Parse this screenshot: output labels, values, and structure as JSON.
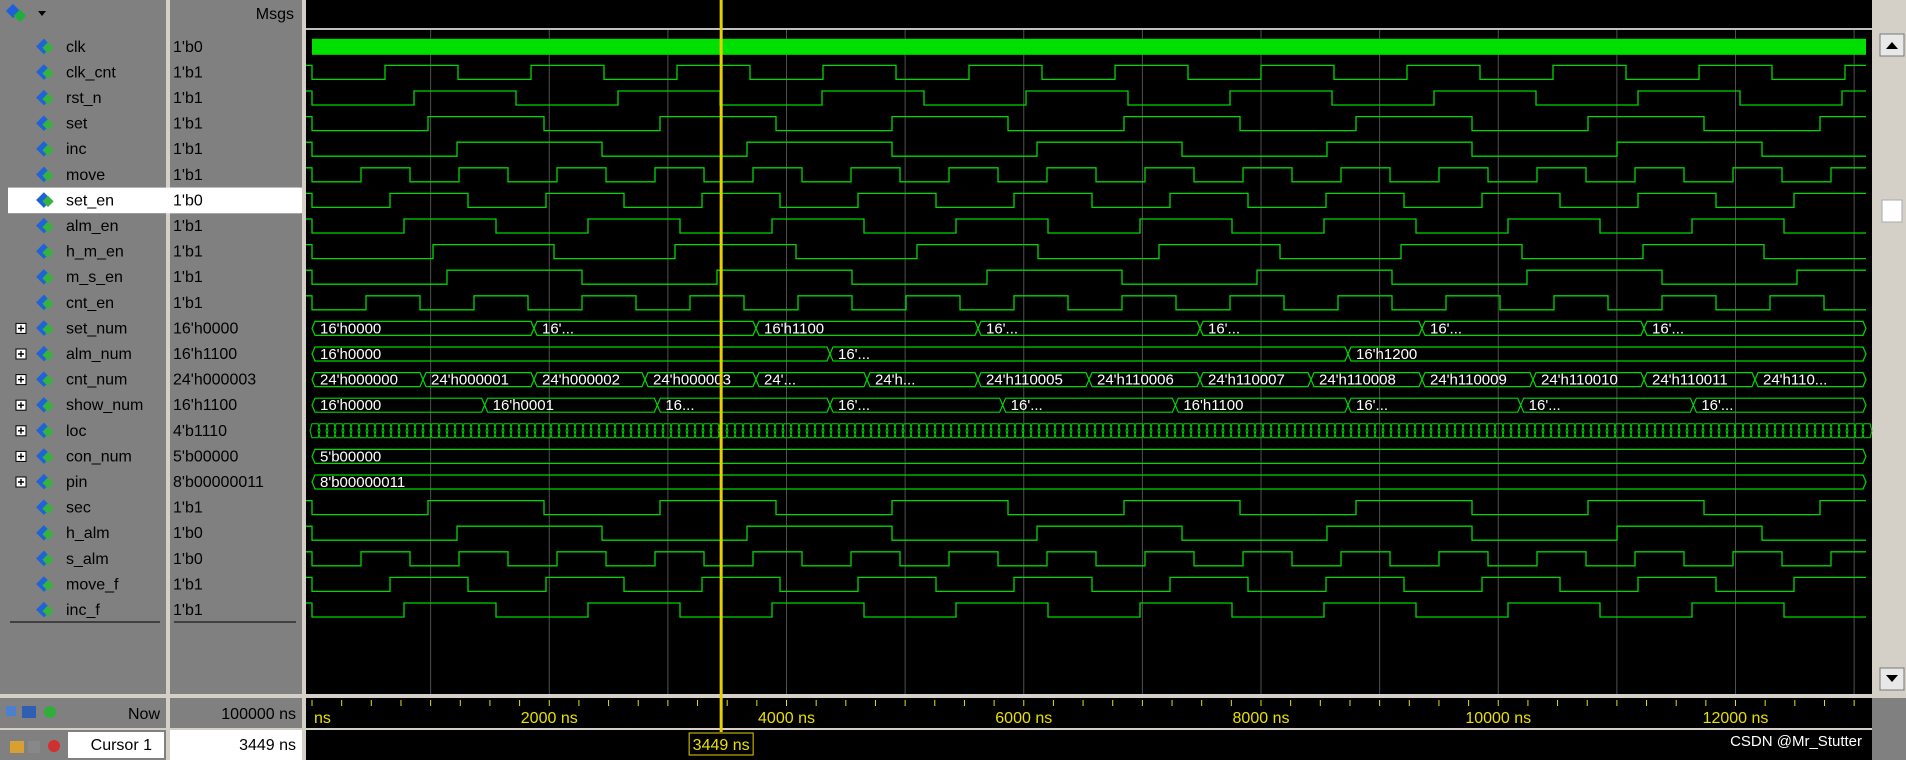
{
  "header": {
    "msgs_label": "Msgs"
  },
  "signals": [
    {
      "name": "clk",
      "value": "1'b0",
      "type": "clk"
    },
    {
      "name": "clk_cnt",
      "value": "1'b1",
      "type": "bit"
    },
    {
      "name": "rst_n",
      "value": "1'b1",
      "type": "bit"
    },
    {
      "name": "set",
      "value": "1'b1",
      "type": "bit"
    },
    {
      "name": "inc",
      "value": "1'b1",
      "type": "bit"
    },
    {
      "name": "move",
      "value": "1'b1",
      "type": "bit"
    },
    {
      "name": "set_en",
      "value": "1'b0",
      "type": "bit",
      "selected": true
    },
    {
      "name": "alm_en",
      "value": "1'b1",
      "type": "bit"
    },
    {
      "name": "h_m_en",
      "value": "1'b1",
      "type": "bit"
    },
    {
      "name": "m_s_en",
      "value": "1'b1",
      "type": "bit"
    },
    {
      "name": "cnt_en",
      "value": "1'b1",
      "type": "bit"
    },
    {
      "name": "set_num",
      "value": "16'h0000",
      "type": "bus",
      "expandable": true,
      "labels": [
        "16'h0000",
        "16'...",
        "16'h1100",
        "16'...",
        "16'...",
        "16'...",
        "16'..."
      ]
    },
    {
      "name": "alm_num",
      "value": "16'h1100",
      "type": "bus",
      "expandable": true,
      "labels": [
        "16'h0000",
        "16'...",
        "16'h1200"
      ]
    },
    {
      "name": "cnt_num",
      "value": "24'h000003",
      "type": "bus",
      "expandable": true,
      "labels": [
        "24'h000000",
        "24'h000001",
        "24'h000002",
        "24'h000003",
        "24'...",
        "24'h...",
        "24'h110005",
        "24'h110006",
        "24'h110007",
        "24'h110008",
        "24'h110009",
        "24'h110010",
        "24'h110011",
        "24'h110..."
      ]
    },
    {
      "name": "show_num",
      "value": "16'h1100",
      "type": "bus",
      "expandable": true,
      "labels": [
        "16'h0000",
        "16'h0001",
        "16...",
        "16'...",
        "16'...",
        "16'h1100",
        "16'...",
        "16'...",
        "16'..."
      ]
    },
    {
      "name": "loc",
      "value": "4'b1110",
      "type": "dense",
      "expandable": true
    },
    {
      "name": "con_num",
      "value": "5'b00000",
      "type": "bus",
      "expandable": true,
      "labels": [
        "5'b00000"
      ]
    },
    {
      "name": "pin",
      "value": "8'b00000011",
      "type": "bus",
      "expandable": true,
      "labels": [
        "8'b00000011"
      ]
    },
    {
      "name": "sec",
      "value": "1'b1",
      "type": "bit"
    },
    {
      "name": "h_alm",
      "value": "1'b0",
      "type": "bit"
    },
    {
      "name": "s_alm",
      "value": "1'b0",
      "type": "bit"
    },
    {
      "name": "move_f",
      "value": "1'b1",
      "type": "bit"
    },
    {
      "name": "inc_f",
      "value": "1'b1",
      "type": "bit"
    }
  ],
  "timeline": {
    "ticks": [
      {
        "time": 0,
        "label": "ns"
      },
      {
        "time": 2000,
        "label": "2000 ns"
      },
      {
        "time": 4000,
        "label": "4000 ns"
      },
      {
        "time": 6000,
        "label": "6000 ns"
      },
      {
        "time": 8000,
        "label": "8000 ns"
      },
      {
        "time": 10000,
        "label": "10000 ns"
      },
      {
        "time": 12000,
        "label": "12000 ns"
      }
    ],
    "range_ns": [
      0,
      13100
    ]
  },
  "cursor": {
    "time_ns": 3449,
    "label": "3449 ns"
  },
  "status": {
    "now_label": "Now",
    "now_value": "100000 ns",
    "cursor_label": "Cursor 1",
    "cursor_value": "3449 ns"
  },
  "watermark": "CSDN @Mr_Stutter",
  "colors": {
    "wave": "#00d800",
    "clk_fill": "#00e000",
    "cursor": "#e8d000",
    "background": "#000000",
    "panel": "#808080",
    "grid": "#505050"
  }
}
